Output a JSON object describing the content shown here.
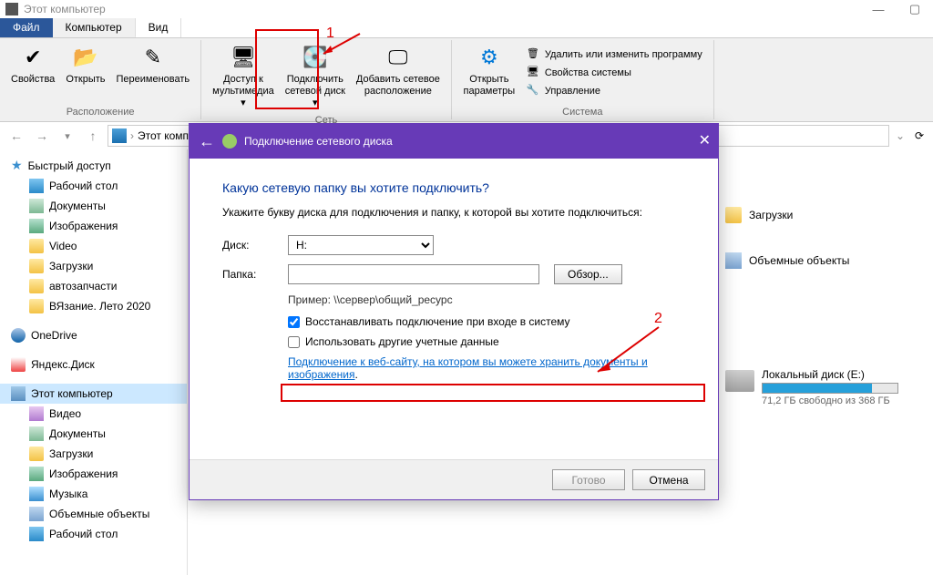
{
  "window": {
    "title": "Этот компьютер"
  },
  "tabs": {
    "file": "Файл",
    "computer": "Компьютер",
    "view": "Вид"
  },
  "ribbon": {
    "group_location": "Расположение",
    "group_network": "Сеть",
    "group_system": "Система",
    "props": "Свойства",
    "open": "Открыть",
    "rename": "Переименовать",
    "media": "Доступ к\nмультимедиа",
    "mapdrive": "Подключить\nсетевой диск",
    "addloc": "Добавить сетевое\nрасположение",
    "openparams": "Открыть\nпараметры",
    "sys1": "Удалить или изменить программу",
    "sys2": "Свойства системы",
    "sys3": "Управление"
  },
  "nav": {
    "breadcrumb": "Этот компьютер"
  },
  "sidebar": {
    "quick": "Быстрый доступ",
    "desktop": "Рабочий стол",
    "docs": "Документы",
    "images": "Изображения",
    "video": "Video",
    "downloads": "Загрузки",
    "autoparts": "автозапчасти",
    "knitting": "ВЯзание. Лето 2020",
    "onedrive": "OneDrive",
    "yandex": "Яндекс.Диск",
    "thispc": "Этот компьютер",
    "s_video": "Видео",
    "s_docs": "Документы",
    "s_downloads": "Загрузки",
    "s_images": "Изображения",
    "s_music": "Музыка",
    "s_objects": "Объемные объекты",
    "s_desktop": "Рабочий стол"
  },
  "content": {
    "downloads": "Загрузки",
    "objects": "Объемные объекты",
    "drive_name": "Локальный диск (E:)",
    "drive_free": "71,2 ГБ свободно из 368 ГБ"
  },
  "wizard": {
    "title": "Подключение сетевого диска",
    "heading": "Какую сетевую папку вы хотите подключить?",
    "desc": "Укажите букву диска для подключения и папку, к которой вы хотите подключиться:",
    "drive_label": "Диск:",
    "drive_value": "H:",
    "folder_label": "Папка:",
    "browse": "Обзор...",
    "example": "Пример: \\\\сервер\\общий_ресурс",
    "chk1": "Восстанавливать подключение при входе в систему",
    "chk2": "Использовать другие учетные данные",
    "link": "Подключение к веб-сайту, на котором вы можете хранить документы и изображения",
    "done": "Готово",
    "cancel": "Отмена"
  },
  "anno": {
    "one": "1",
    "two": "2"
  }
}
